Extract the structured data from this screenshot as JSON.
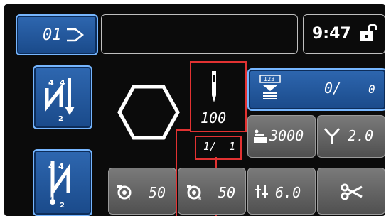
{
  "pattern": {
    "label": "01"
  },
  "clock": {
    "time": "9:47"
  },
  "stitch_count": {
    "value": "100"
  },
  "step": {
    "value": "1/  1"
  },
  "bobbin_counter": {
    "value": "0/",
    "limit": "0"
  },
  "speed": {
    "value": "3000"
  },
  "stitch_length": {
    "value": "2.0"
  },
  "tension_left": {
    "value": "50"
  },
  "tension_right": {
    "value": "50"
  },
  "feed": {
    "value": "6.0"
  },
  "colors": {
    "accent_blue": "#2e67b0",
    "highlight_red": "#e23232",
    "panel_gray": "#6a6a6a"
  }
}
